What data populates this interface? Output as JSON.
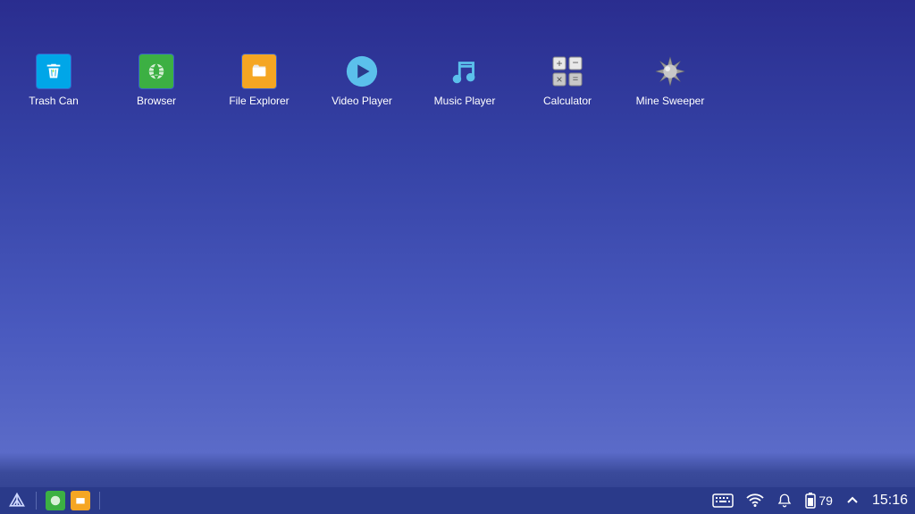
{
  "desktop": {
    "icons": [
      {
        "name": "trash-can",
        "label": "Trash Can"
      },
      {
        "name": "browser",
        "label": "Browser"
      },
      {
        "name": "file-explorer",
        "label": "File Explorer"
      },
      {
        "name": "video-player",
        "label": "Video Player"
      },
      {
        "name": "music-player",
        "label": "Music Player"
      },
      {
        "name": "calculator",
        "label": "Calculator"
      },
      {
        "name": "mine-sweeper",
        "label": "Mine Sweeper"
      }
    ]
  },
  "taskbar": {
    "battery_level": "79",
    "clock": "15:16"
  }
}
